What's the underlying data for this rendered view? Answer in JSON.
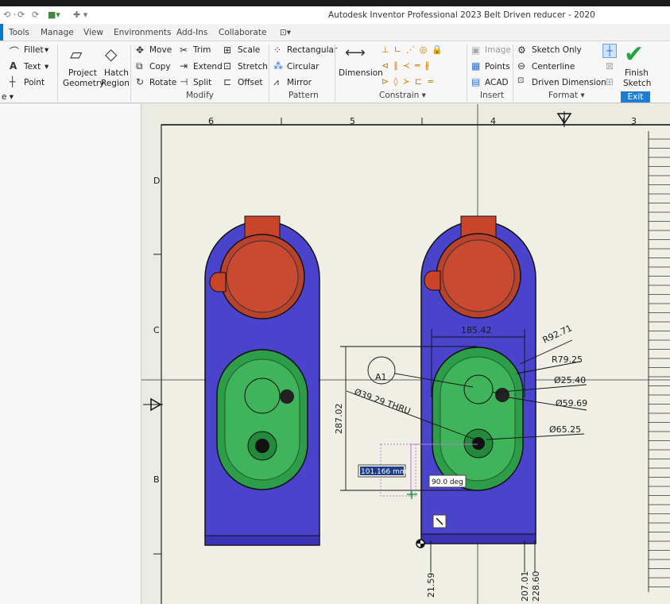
{
  "window": {
    "title": "Autodesk Inventor Professional 2023   Belt Driven reducer - 2020"
  },
  "menu": [
    "Tools",
    "Manage",
    "View",
    "Environments",
    "Add-Ins",
    "Collaborate"
  ],
  "ribbon": {
    "draw": {
      "fillet": "Fillet",
      "text": "Text",
      "point": "Point"
    },
    "project_geometry": [
      "Project",
      "Geometry"
    ],
    "hatch_region": [
      "Hatch",
      "Region"
    ],
    "modify": {
      "move": "Move",
      "copy": "Copy",
      "rotate": "Rotate",
      "trim": "Trim",
      "extend": "Extend",
      "split": "Split",
      "scale": "Scale",
      "stretch": "Stretch",
      "offset": "Offset",
      "title": "Modify"
    },
    "pattern": {
      "rectangular": "Rectangular",
      "circular": "Circular",
      "mirror": "Mirror",
      "title": "Pattern"
    },
    "constrain": {
      "dimension": "Dimension",
      "title": "Constrain"
    },
    "insert": {
      "image": "Image",
      "points": "Points",
      "acad": "ACAD",
      "title": "Insert"
    },
    "format": {
      "sketch_only": "Sketch Only",
      "centerline": "Centerline",
      "driven_dimension": "Driven Dimension",
      "title": "Format"
    },
    "exit": {
      "finish": [
        "Finish",
        "Sketch"
      ],
      "title": "Exit"
    }
  },
  "drawing": {
    "zone_columns": [
      "6",
      "5",
      "4",
      "3"
    ],
    "zone_rows": [
      "D",
      "C",
      "B"
    ],
    "dimensions": {
      "width": "185.42",
      "r1": "R92.71",
      "r2": "R79.25",
      "d1": "Ø25.40",
      "d2": "Ø59.69",
      "d3": "Ø65.25",
      "thru": "Ø39.29 THRU",
      "height": "287.02",
      "b1": "21.59",
      "b2": "207.01",
      "b3": "228.60",
      "label": "A1"
    },
    "input_value": "101.166 mm",
    "angle_value": "90.0 deg"
  }
}
